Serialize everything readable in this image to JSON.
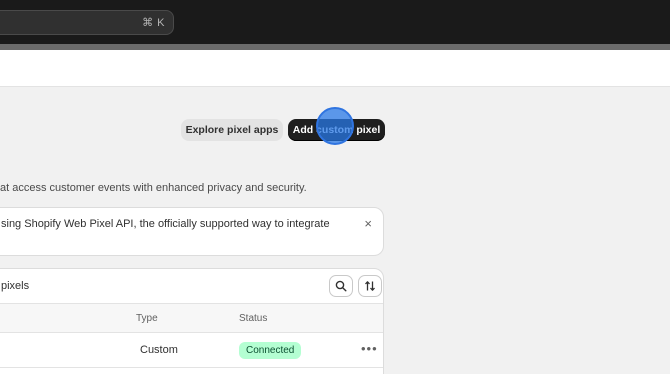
{
  "topbar": {
    "search_shortcut": "⌘ K"
  },
  "actions": {
    "explore_label": "Explore pixel apps",
    "add_label": "Add custom pixel"
  },
  "description": "at access customer events with enhanced privacy and security.",
  "banner": {
    "text": "sing Shopify Web Pixel API, the officially supported way to integrate",
    "close_glyph": "×"
  },
  "pixels_card": {
    "title": "pixels",
    "columns": {
      "type": "Type",
      "status": "Status"
    },
    "rows": [
      {
        "type": "Custom",
        "status": "Connected",
        "more_glyph": "•••"
      }
    ]
  },
  "colors": {
    "primary_button": "#1f1f1f",
    "status_connected_bg": "#b4fed2",
    "status_connected_text": "#0c5132",
    "cursor_highlight": "#2f74e0"
  }
}
